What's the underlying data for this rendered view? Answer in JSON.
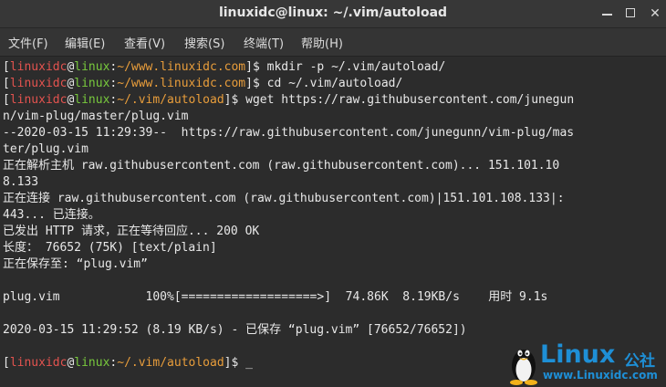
{
  "window": {
    "title": "linuxidc@linux: ~/.vim/autoload",
    "controls": [
      "minimize",
      "maximize",
      "close"
    ]
  },
  "menu": [
    "文件(F)",
    "编辑(E)",
    "查看(V)",
    "搜索(S)",
    "终端(T)",
    "帮助(H)"
  ],
  "prompt": {
    "user": "linuxidc",
    "at": "@",
    "host": "linux"
  },
  "lines": [
    {
      "type": "prompt",
      "path": "~/www.linuxidc.com",
      "cmd": "mkdir -p ~/.vim/autoload/"
    },
    {
      "type": "prompt",
      "path": "~/www.linuxidc.com",
      "cmd": "cd ~/.vim/autoload/"
    },
    {
      "type": "prompt",
      "path": "~/.vim/autoload",
      "cmd": "wget https://raw.githubusercontent.com/junegun"
    },
    {
      "type": "text",
      "text": "n/vim-plug/master/plug.vim"
    },
    {
      "type": "text",
      "text": "--2020-03-15 11:29:39--  https://raw.githubusercontent.com/junegunn/vim-plug/mas"
    },
    {
      "type": "text",
      "text": "ter/plug.vim"
    },
    {
      "type": "text",
      "text": "正在解析主机 raw.githubusercontent.com (raw.githubusercontent.com)... 151.101.10"
    },
    {
      "type": "text",
      "text": "8.133"
    },
    {
      "type": "text",
      "text": "正在连接 raw.githubusercontent.com (raw.githubusercontent.com)|151.101.108.133|:"
    },
    {
      "type": "text",
      "text": "443... 已连接。"
    },
    {
      "type": "text",
      "text": "已发出 HTTP 请求，正在等待回应... 200 OK"
    },
    {
      "type": "text",
      "text": "长度： 76652 (75K) [text/plain]"
    },
    {
      "type": "text",
      "text": "正在保存至: “plug.vim”"
    },
    {
      "type": "text",
      "text": ""
    },
    {
      "type": "text",
      "text": "plug.vim            100%[===================>]  74.86K  8.19KB/s    用时 9.1s"
    },
    {
      "type": "text",
      "text": ""
    },
    {
      "type": "text",
      "text": "2020-03-15 11:29:52 (8.19 KB/s) - 已保存 “plug.vim” [76652/76652])"
    },
    {
      "type": "text",
      "text": ""
    },
    {
      "type": "prompt",
      "path": "~/.vim/autoload",
      "cmd": "_"
    }
  ],
  "watermark": {
    "brand": "Linux",
    "brand_cn": "公社",
    "url": "www.Linuxidc.com"
  },
  "colors": {
    "user": "#e3534f",
    "host": "#78c93d",
    "path": "#e89d3b",
    "logo": "#1e8fd6"
  }
}
